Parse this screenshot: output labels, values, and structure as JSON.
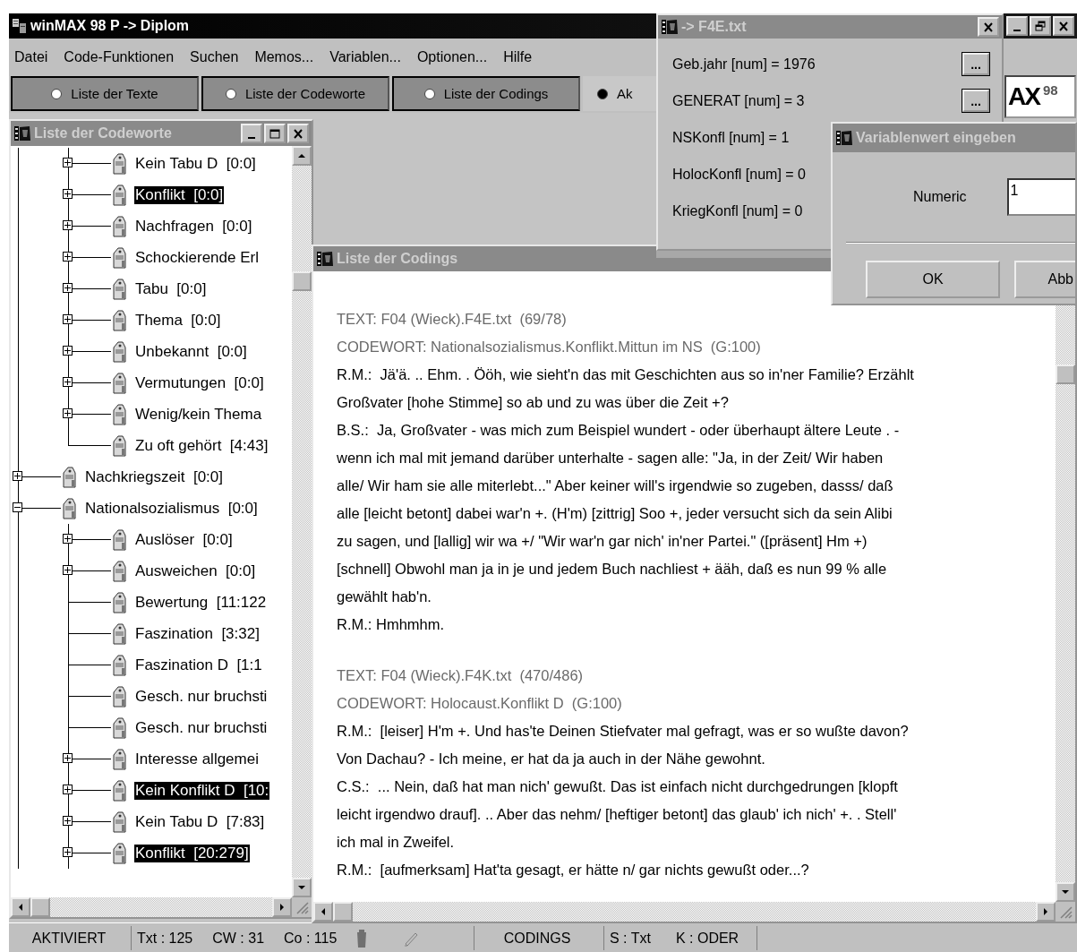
{
  "window": {
    "title": "winMAX 98 P -> Diplom"
  },
  "menu": [
    "Datei",
    "Code-Funktionen",
    "Suchen",
    "Memos...",
    "Variablen...",
    "Optionen...",
    "Hilfe"
  ],
  "tabs": [
    {
      "label": "Liste der Texte",
      "selected": false
    },
    {
      "label": "Liste der Codeworte",
      "selected": false
    },
    {
      "label": "Liste der Codings",
      "selected": false
    },
    {
      "label": "Ak",
      "selected": true
    }
  ],
  "logo": {
    "letters": "AX",
    "number": "98"
  },
  "codeword_window": {
    "title": "Liste der Codeworte",
    "tree": {
      "continued_children": [
        {
          "label": "Kein Tabu D  [0:0]",
          "has_children": true,
          "expanded": false,
          "selected": false
        },
        {
          "label": "Konflikt  [0:0]",
          "has_children": true,
          "expanded": false,
          "selected": true
        },
        {
          "label": "Nachfragen  [0:0]",
          "has_children": true,
          "expanded": false,
          "selected": false
        },
        {
          "label": "Schockierende Erl",
          "has_children": true,
          "expanded": false,
          "selected": false
        },
        {
          "label": "Tabu  [0:0]",
          "has_children": true,
          "expanded": false,
          "selected": false
        },
        {
          "label": "Thema  [0:0]",
          "has_children": true,
          "expanded": false,
          "selected": false
        },
        {
          "label": "Unbekannt  [0:0]",
          "has_children": true,
          "expanded": false,
          "selected": false
        },
        {
          "label": "Vermutungen  [0:0]",
          "has_children": true,
          "expanded": false,
          "selected": false
        },
        {
          "label": "Wenig/kein Thema",
          "has_children": true,
          "expanded": false,
          "selected": false
        },
        {
          "label": "Zu oft gehört  [4:43]",
          "has_children": false,
          "selected": false
        }
      ],
      "items": [
        {
          "label": "Nachkriegszeit  [0:0]",
          "has_children": true,
          "expanded": false,
          "selected": false
        },
        {
          "label": "Nationalsozialismus  [0:0]",
          "has_children": true,
          "expanded": true,
          "selected": false,
          "children": [
            {
              "label": "Auslöser  [0:0]",
              "has_children": true,
              "expanded": false,
              "selected": false
            },
            {
              "label": "Ausweichen  [0:0]",
              "has_children": true,
              "expanded": false,
              "selected": false
            },
            {
              "label": "Bewertung  [11:122",
              "has_children": false,
              "selected": false
            },
            {
              "label": "Faszination  [3:32]",
              "has_children": false,
              "selected": false
            },
            {
              "label": "Faszination D  [1:1",
              "has_children": false,
              "selected": false
            },
            {
              "label": "Gesch. nur bruchsti",
              "has_children": false,
              "selected": false
            },
            {
              "label": "Gesch. nur bruchsti",
              "has_children": false,
              "selected": false
            },
            {
              "label": "Interesse allgemei",
              "has_children": true,
              "expanded": false,
              "selected": false
            },
            {
              "label": "Kein Konflikt D  [10:",
              "has_children": true,
              "expanded": false,
              "selected": true
            },
            {
              "label": "Kein Tabu D  [7:83]",
              "has_children": true,
              "expanded": false,
              "selected": false
            },
            {
              "label": "Konflikt  [20:279]",
              "has_children": true,
              "expanded": false,
              "selected": true
            }
          ]
        }
      ]
    }
  },
  "codings_window": {
    "title": "Liste der Codings",
    "codings": [
      {
        "text": "TEXT: F04 (Wieck).F4E.txt  (69/78)",
        "codeword": "CODEWORT: Nationalsozialismus.Konflikt.Mittun im NS  (G:100)",
        "lines": [
          "R.M.:  Jä'ä. .. Ehm. . Ööh, wie sieht'n das mit Geschichten aus so in'ner Familie? Erzählt",
          "Großvater [hohe Stimme] so ab und zu was über die Zeit +?",
          "B.S.:  Ja, Großvater - was mich zum Beispiel wundert - oder überhaupt ältere Leute . -",
          "wenn ich mal mit jemand darüber unterhalte - sagen alle: \"Ja, in der Zeit/ Wir haben",
          "alle/ Wir ham sie alle miterlebt...\" Aber keiner will's irgendwie so zugeben, dasss/ daß",
          "alle [leicht betont] dabei war'n +. (H'm) [zittrig] Soo +, jeder versucht sich da sein Alibi",
          "zu sagen, und [lallig] wir wa +/ \"Wir war'n gar nich' in'ner Partei.\" ([präsent] Hm +)",
          "[schnell] Obwohl man ja in je und jedem Buch nachliest + ääh, daß es nun 99 % alle",
          "gewählt hab'n.",
          "R.M.: Hmhmhm."
        ]
      },
      {
        "text": "TEXT: F04 (Wieck).F4K.txt  (470/486)",
        "codeword": "CODEWORT: Holocaust.Konflikt D  (G:100)",
        "lines": [
          "R.M.:  [leiser] H'm +. Und has'te Deinen Stiefvater mal gefragt, was er so wußte davon?",
          "Von Dachau? - Ich meine, er hat da ja auch in der Nähe gewohnt.",
          "C.S.:  ... Nein, daß hat man nich' gewußt. Das ist einfach nicht durchgedrungen [klopft",
          "leicht irgendwo drauf]. .. Aber das nehm/ [heftiger betont] das glaub' ich nich' +. . Stell'",
          "ich mal in Zweifel.",
          "R.M.:  [aufmerksam] Hat'ta gesagt, er hätte n/ gar nichts gewußt oder...?"
        ]
      }
    ]
  },
  "variables_window": {
    "title": "-> F4E.txt",
    "variables": [
      {
        "label": "Geb.jahr [num] = 1976",
        "button": "..."
      },
      {
        "label": "GENERAT [num] = 3",
        "button": "..."
      },
      {
        "label": "NSKonfl [num] = 1"
      },
      {
        "label": "HolocKonfl [num] = 0"
      },
      {
        "label": "KriegKonfl [num] = 0"
      }
    ]
  },
  "dialog": {
    "title": "Variablenwert eingeben",
    "field_label": "Numeric",
    "value": "1",
    "buttons": [
      "OK",
      "Abb"
    ]
  },
  "status_bar": {
    "mode": "AKTIVIERT",
    "counts": [
      "Txt : 125",
      "CW : 31",
      "Co : 115"
    ],
    "view": "CODINGS",
    "settings": [
      "S : Txt",
      "K : ODER"
    ]
  }
}
